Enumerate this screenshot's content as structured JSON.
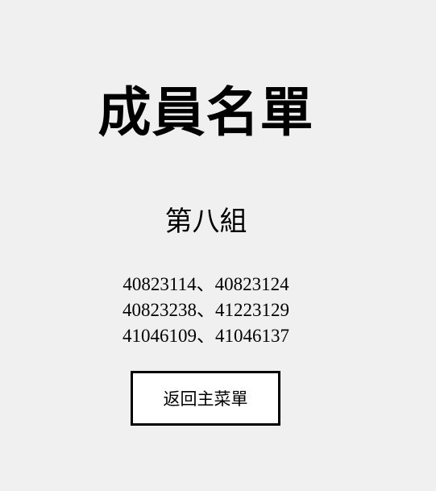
{
  "page": {
    "title": "成員名單",
    "group_name": "第八組",
    "member_lines": [
      "40823114、40823124",
      "40823238、41223129",
      "41046109、41046137"
    ],
    "back_button_label": "返回主菜單"
  },
  "colors": {
    "background": "#f0f0f0",
    "text": "#000000",
    "button_background": "#ffffff",
    "button_border": "#000000"
  }
}
